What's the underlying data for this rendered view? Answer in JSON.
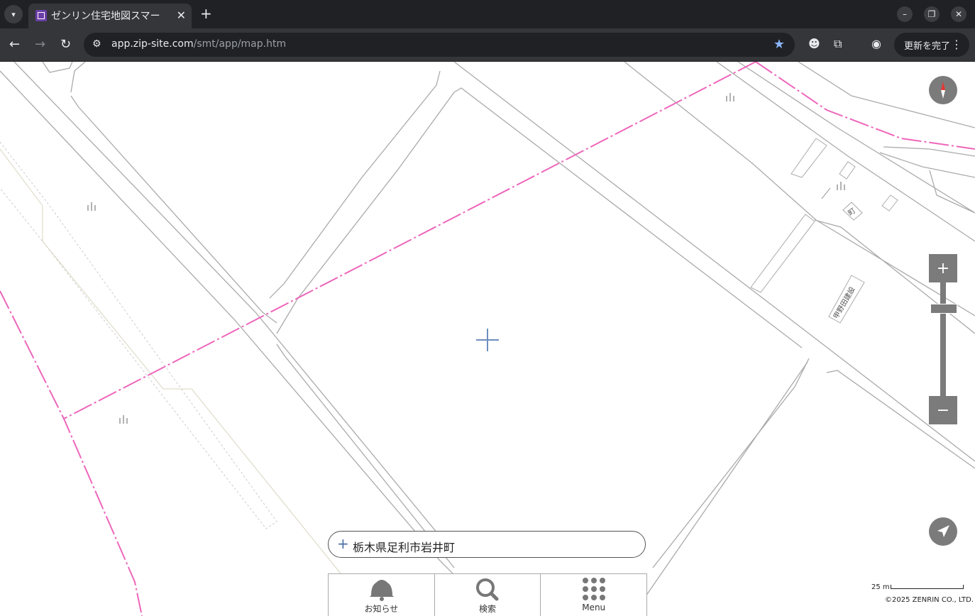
{
  "browser": {
    "tab_title": "ゼンリン住宅地図スマー",
    "url_host": "app.zip-site.com",
    "url_path": "/smt/app/map.htm",
    "update_label": "更新を完了"
  },
  "map": {
    "labels": {
      "label_a": "町",
      "label_b": "甲野田建設"
    }
  },
  "address": {
    "text": "栃木県足利市岩井町"
  },
  "menu": {
    "items": [
      {
        "label": "お知らせ",
        "icon": "bell-icon"
      },
      {
        "label": "検索",
        "icon": "search-icon"
      },
      {
        "label": "Menu",
        "icon": "grid-icon"
      }
    ]
  },
  "scale": {
    "label": "25 m"
  },
  "copyright": "©2025 ZENRIN CO., LTD."
}
